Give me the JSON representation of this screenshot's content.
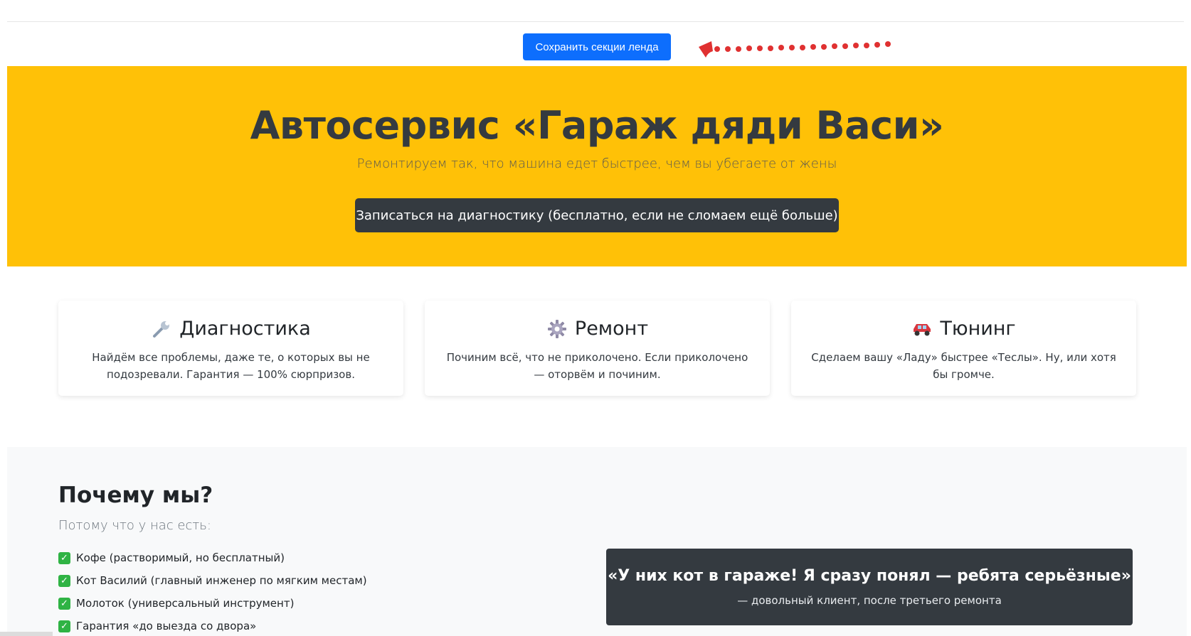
{
  "toolbar": {
    "save_label": "Сохранить секции ленда"
  },
  "hero": {
    "title": "Автосервис «Гараж дяди Васи»",
    "subtitle": "Ремонтируем так, что машина едет быстрее, чем вы убегаете от жены",
    "cta_label": "Записаться на диагностику (бесплатно, если не сломаем ещё больше)",
    "background_color": "#ffc107"
  },
  "services": [
    {
      "icon": "wrench-icon",
      "title": "Диагностика",
      "text": "Найдём все проблемы, даже те, о которых вы не подозревали. Гарантия — 100% сюрпризов."
    },
    {
      "icon": "gear-icon",
      "title": "Ремонт",
      "text": "Починим всё, что не приколочено. Если приколочено — оторвём и починим."
    },
    {
      "icon": "car-icon",
      "title": "Тюнинг",
      "text": "Сделаем вашу «Ладу» быстрее «Теслы». Ну, или хотя бы громче."
    }
  ],
  "why": {
    "title": "Почему мы?",
    "subtitle": "Потому что у нас есть:",
    "items": [
      "Кофе (растворимый, но бесплатный)",
      "Кот Василий (главный инженер по мягким местам)",
      "Молоток (универсальный инструмент)",
      "Гарантия «до выезда со двора»"
    ]
  },
  "quote": {
    "text": "«У них кот в гараже! Я сразу понял — ребята серьёзные»",
    "author": "— довольный клиент, после третьего ремонта"
  },
  "colors": {
    "primary_button": "#0d6efd",
    "dark": "#343a40",
    "annotation_arrow": "#e03131",
    "check": "#2fb344"
  }
}
